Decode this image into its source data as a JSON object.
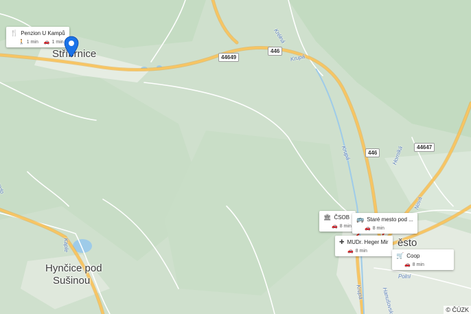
{
  "places": {
    "strmnice": "Stříbrnice",
    "mesto": "ěsto",
    "hyncice_line1": "Hynčice pod",
    "hyncice_line2": "Sušinou"
  },
  "roads": {
    "r446_a": "446",
    "r446_b": "446",
    "r44649": "44649",
    "r44647": "44647"
  },
  "road_names": {
    "krupa_1": "Krupá",
    "krupa_2": "Krupá",
    "krupa_3": "Krupá",
    "kretna": "Kréłná",
    "horni": "Horníká",
    "nova": "Nová",
    "kaple": "Kaple",
    "polni": "Polní",
    "hanusov": "Hanušovská",
    "lordo": "rado"
  },
  "pois": [
    {
      "name": "Penzion U Kampů",
      "icon": "restaurant-icon",
      "walk": "1 min",
      "drive": "1 min"
    },
    {
      "name": "ČSOB",
      "icon": "bank-icon",
      "drive": "8 min"
    },
    {
      "name": "Staré mesto pod ...",
      "icon": "bus-icon",
      "drive": "8 min"
    },
    {
      "name": "MUDr. Heger Mir",
      "icon": "medical-icon",
      "drive": "8 min"
    },
    {
      "name": "Coop",
      "icon": "cart-icon",
      "drive": "8 min"
    }
  ],
  "attribution": "© ČÚZK",
  "colors": {
    "terrain": "#cfe0cd",
    "forest": "#bcd6b9",
    "road_major": "#f8c562",
    "road_minor": "#ffffff",
    "water": "#9ecbe9",
    "pin": "#1a73e8"
  }
}
